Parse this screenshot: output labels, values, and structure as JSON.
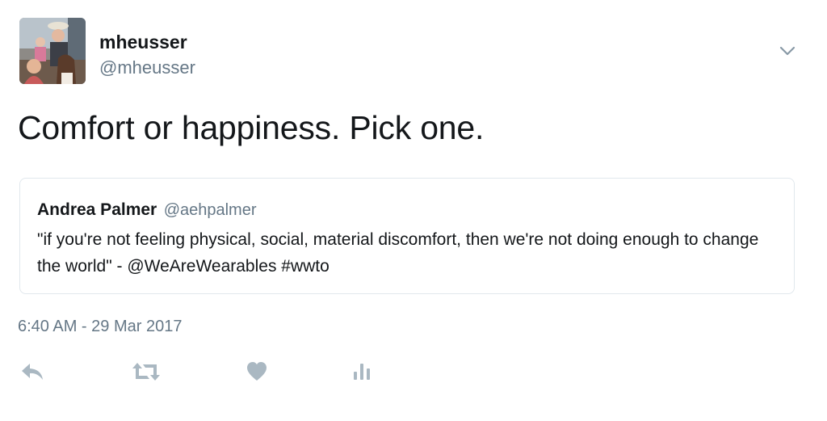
{
  "tweet": {
    "author": {
      "display_name": "mheusser",
      "screen_name": "@mheusser"
    },
    "text": "Comfort or happiness. Pick one.",
    "timestamp": "6:40 AM - 29 Mar 2017"
  },
  "quoted_tweet": {
    "author_name": "Andrea Palmer",
    "author_handle": "@aehpalmer",
    "text": "\"if you're not feeling physical, social, material discomfort, then we're not doing enough to change the world\" - @WeAreWearables #wwto"
  },
  "actions": {
    "reply_icon": "reply-icon",
    "retweet_icon": "retweet-icon",
    "like_icon": "heart-icon",
    "analytics_icon": "analytics-icon"
  },
  "colors": {
    "text_primary": "#14171a",
    "text_secondary": "#657786",
    "icon_gray": "#aab8c2",
    "border": "#e1e8ed"
  }
}
